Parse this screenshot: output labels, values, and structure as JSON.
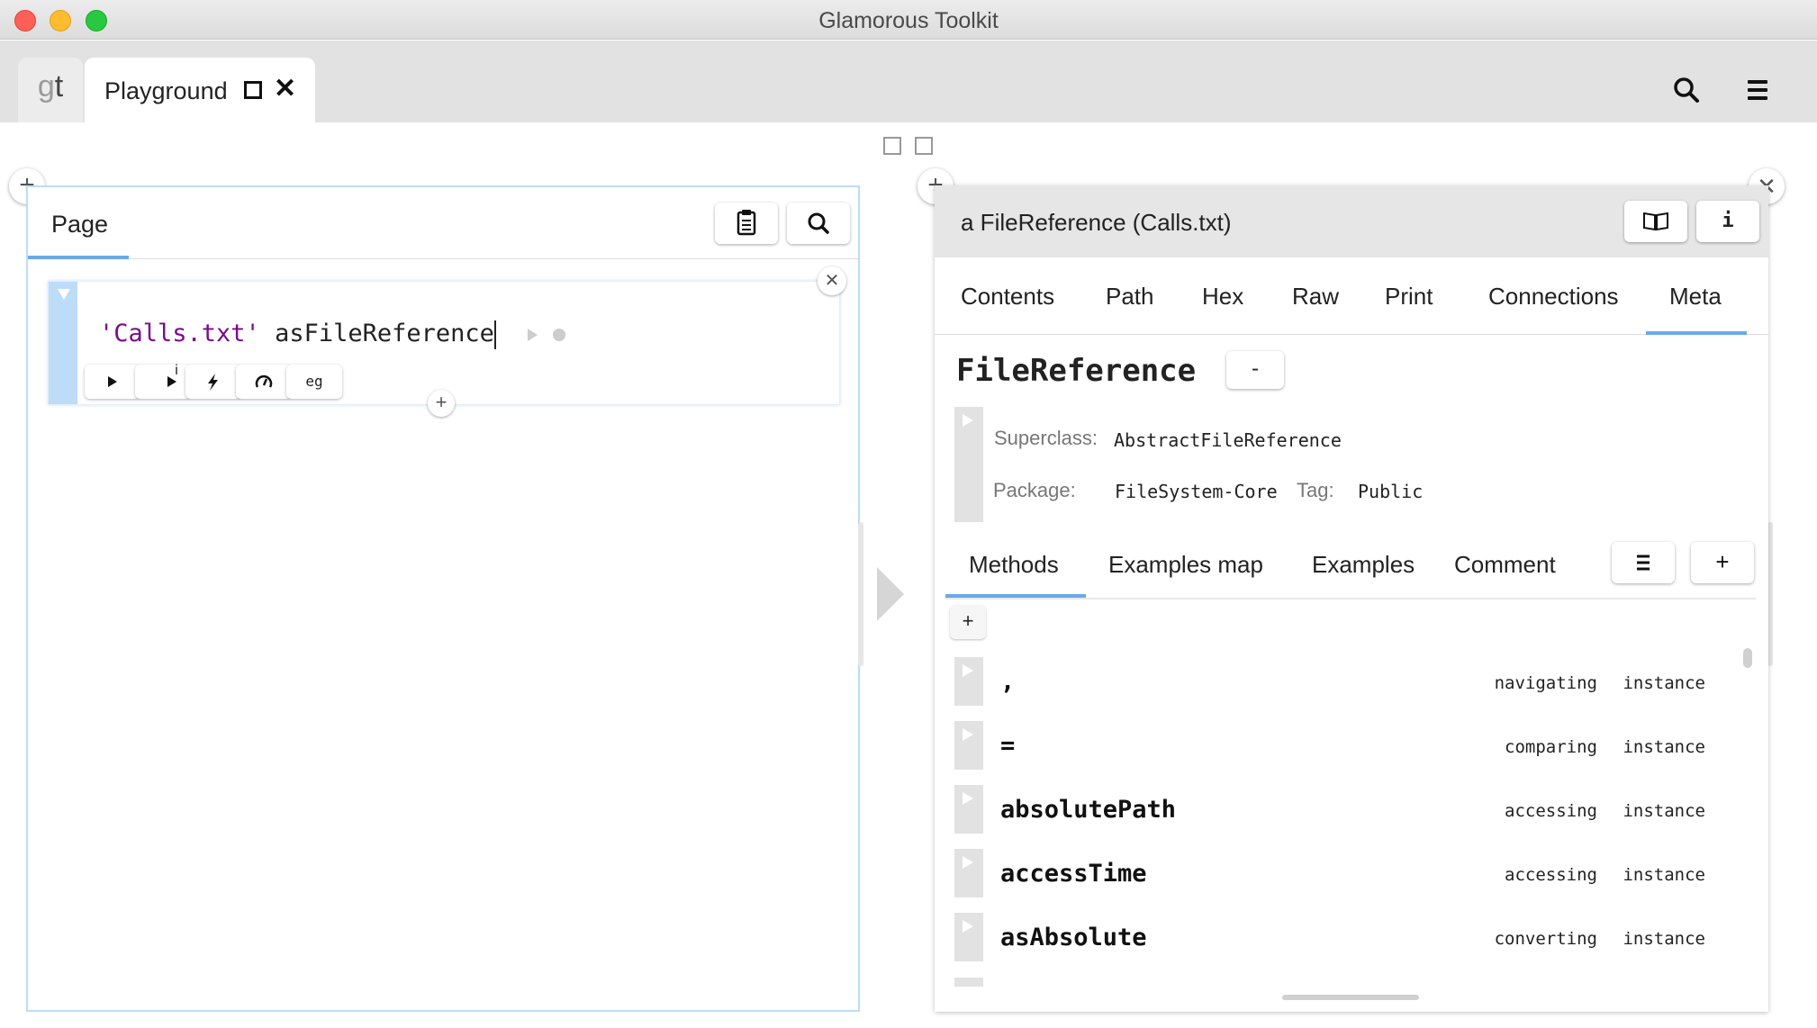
{
  "window": {
    "title": "Glamorous Toolkit"
  },
  "tabs": {
    "logo_g": "g",
    "logo_t": "t",
    "playground_label": "Playground"
  },
  "left_pane": {
    "title": "Page",
    "snippet": {
      "code_string": "'Calls.txt'",
      "code_message": "asFileReference",
      "buttons": [
        {
          "icon": "play-icon",
          "label": ""
        },
        {
          "icon": "play-inspect-icon",
          "label": "i"
        },
        {
          "icon": "lightning-icon",
          "label": ""
        },
        {
          "icon": "gauge-icon",
          "label": ""
        },
        {
          "icon": "examples-icon",
          "label": "eg"
        }
      ]
    }
  },
  "right_pane": {
    "title": "a FileReference (Calls.txt)",
    "view_tabs": [
      "Contents",
      "Path",
      "Hex",
      "Raw",
      "Print",
      "Connections",
      "Meta"
    ],
    "active_view_tab": "Meta",
    "class_name": "FileReference",
    "collapse_label": "-",
    "superclass_label": "Superclass:",
    "superclass_value": "AbstractFileReference",
    "package_label": "Package:",
    "package_value": "FileSystem-Core",
    "tag_label": "Tag:",
    "tag_value": "Public",
    "sub_tabs": [
      "Methods",
      "Examples map",
      "Examples",
      "Comment"
    ],
    "active_sub_tab": "Methods",
    "add_label": "+",
    "methods": [
      {
        "name": ",",
        "category": "navigating",
        "side": "instance"
      },
      {
        "name": "=",
        "category": "comparing",
        "side": "instance"
      },
      {
        "name": "absolutePath",
        "category": "accessing",
        "side": "instance"
      },
      {
        "name": "accessTime",
        "category": "accessing",
        "side": "instance"
      },
      {
        "name": "asAbsolute",
        "category": "converting",
        "side": "instance"
      }
    ]
  },
  "colors": {
    "accent_blue": "#6aa9e9",
    "string_literal": "#7b0a8f",
    "snippet_bar": "#bcdcf8"
  }
}
